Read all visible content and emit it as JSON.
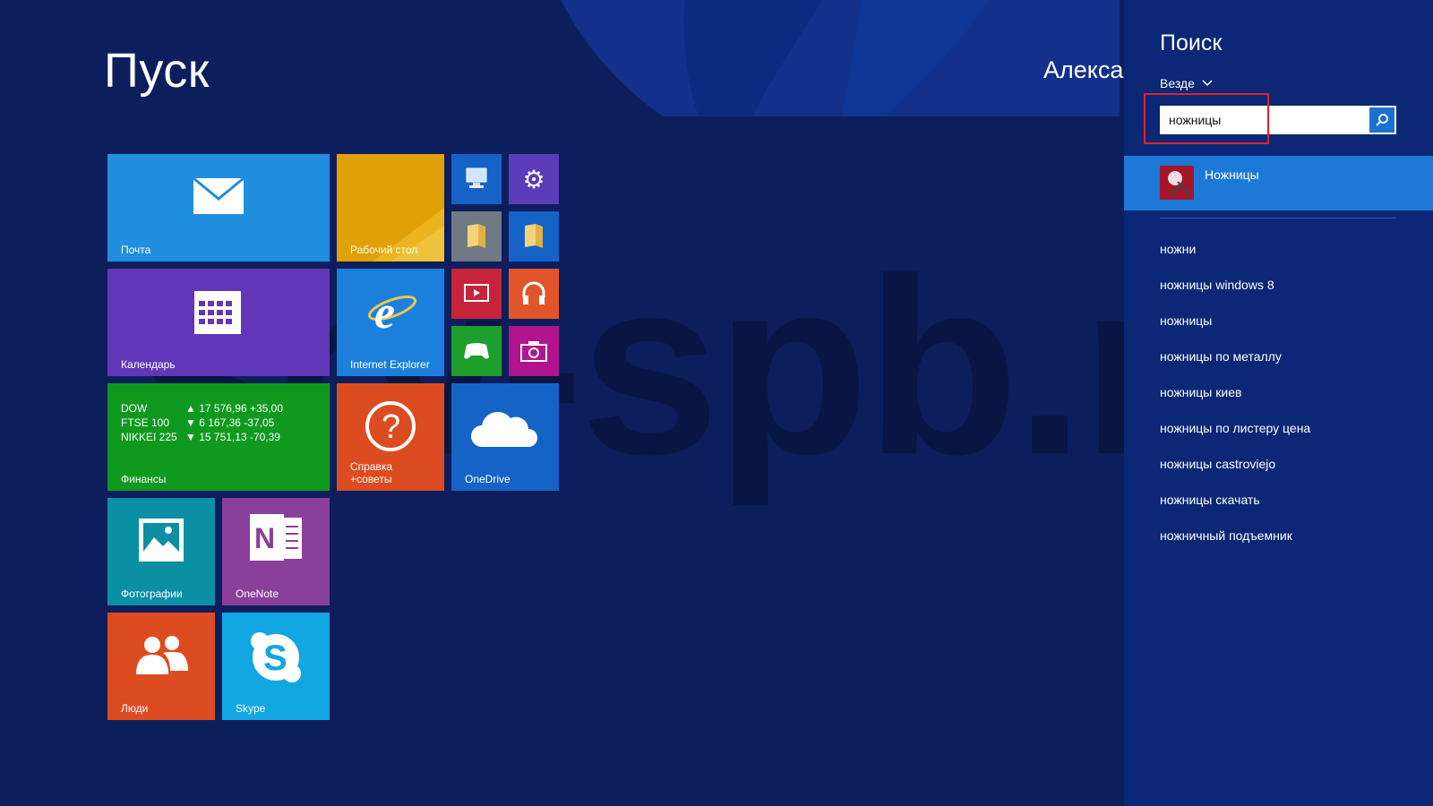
{
  "start": {
    "title": "Пуск",
    "user": "Александр"
  },
  "watermark": "srv-spb.ru",
  "tiles": {
    "mail": "Почта",
    "desktop": "Рабочий стол",
    "calendar": "Календарь",
    "ie": "Internet Explorer",
    "finance": "Финансы",
    "help": "Справка +советы",
    "onedrive": "OneDrive",
    "photos": "Фотографии",
    "onenote": "OneNote",
    "people": "Люди",
    "skype": "Skype"
  },
  "finance_rows": [
    {
      "name": "DOW",
      "dir": "▲",
      "value": "17 576,96 +35,00"
    },
    {
      "name": "FTSE 100",
      "dir": "▼",
      "value": "6 167,36 -37,05"
    },
    {
      "name": "NIKKEI 225",
      "dir": "▼",
      "value": "15 751,13 -70,39"
    }
  ],
  "search": {
    "title": "Поиск",
    "scope": "Везде",
    "query": "ножницы",
    "result": "Ножницы",
    "suggestions": [
      "ножни",
      "ножницы windows 8",
      "ножницы",
      "ножницы по металлу",
      "ножницы киев",
      "ножницы по листеру цена",
      "ножницы castroviejo",
      "ножницы скачать",
      "ножничный подъемник"
    ]
  },
  "colors": {
    "background": "#0d1e5c",
    "charm": "#0b2775",
    "result_highlight": "#1d78d8",
    "annotation": "#e32126"
  }
}
